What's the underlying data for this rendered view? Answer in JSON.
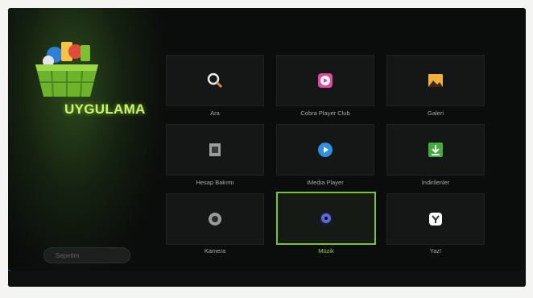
{
  "app": {
    "title": "UYGULAMA",
    "storage_label": "Sepetim"
  },
  "tiles": [
    {
      "label": "Ara",
      "icon": "search-icon",
      "color": "#e8e8e8"
    },
    {
      "label": "Cobra Player Club",
      "icon": "media-play-pink-icon",
      "color": "#e24aa0"
    },
    {
      "label": "Galeri",
      "icon": "gallery-icon",
      "color": "#f0b03a"
    },
    {
      "label": "Hesap Bakımı",
      "icon": "document-icon",
      "color": "#bfbfbf"
    },
    {
      "label": "iMedia Player",
      "icon": "play-circle-icon",
      "color": "#2f8fe0"
    },
    {
      "label": "İndirilenler",
      "icon": "download-icon",
      "color": "#3fae3a"
    },
    {
      "label": "Kamera",
      "icon": "camera-lens-icon",
      "color": "#9a9a9a"
    },
    {
      "label": "Müzik",
      "icon": "music-icon",
      "color": "#5a6ad8"
    },
    {
      "label": "Yaz!",
      "icon": "y-logo-icon",
      "color": "#ffffff"
    }
  ],
  "selected_index": 7
}
